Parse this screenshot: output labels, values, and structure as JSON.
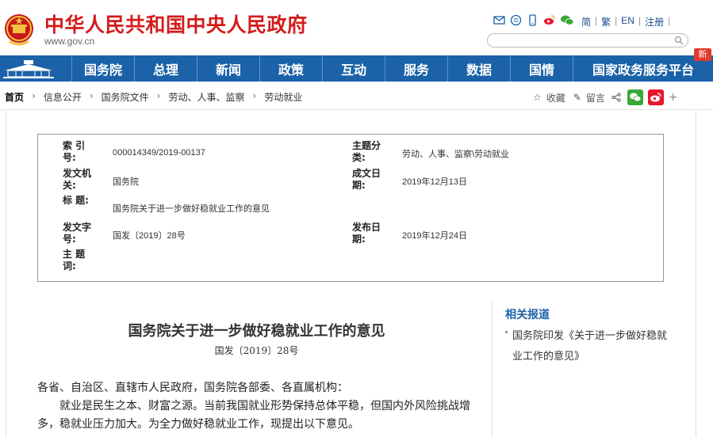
{
  "header": {
    "title": "中华人民共和国中央人民政府",
    "domain": "www.gov.cn",
    "lang_links": [
      "简",
      "繁",
      "EN",
      "注册"
    ],
    "search": {
      "placeholder": "",
      "value": ""
    }
  },
  "nav": {
    "items": [
      "国务院",
      "总理",
      "新闻",
      "政策",
      "互动",
      "服务",
      "数据",
      "国情",
      "国家政务服务平台"
    ],
    "badge": "新"
  },
  "breadcrumb": {
    "items": [
      "首页",
      "信息公开",
      "国务院文件",
      "劳动、人事、监察",
      "劳动就业"
    ]
  },
  "tools": {
    "favorite": "收藏",
    "comment": "留言",
    "more": "+"
  },
  "info": {
    "index_label": "索 引 号:",
    "index_value": "000014349/2019-00137",
    "category_label": "主题分类:",
    "category_value": "劳动、人事、监察\\劳动就业",
    "issuer_label": "发文机关:",
    "issuer_value": "国务院",
    "date_written_label": "成文日期:",
    "date_written_value": "2019年12月13日",
    "title_label": "标 题:",
    "title_value": "国务院关于进一步做好稳就业工作的意见",
    "doc_no_label": "发文字号:",
    "doc_no_value": "国发〔2019〕28号",
    "publish_label": "发布日期:",
    "publish_value": "2019年12月24日",
    "keywords_label": "主 题 词:",
    "keywords_value": ""
  },
  "article": {
    "title": "国务院关于进一步做好稳就业工作的意见",
    "doc_no": "国发〔2019〕28号",
    "salutation": "各省、自治区、直辖市人民政府，国务院各部委、各直属机构：",
    "para1_line1": "就业是民生之本、财富之源。当前我国就业形势保持总体平稳，但国内外风险挑战增",
    "para1_line2": "多，稳就业压力加大。为全力做好稳就业工作，现提出以下意见。"
  },
  "sidebar": {
    "heading": "相关报道",
    "links": [
      "国务院印发《关于进一步做好稳就业工作的意见》"
    ]
  },
  "colors": {
    "brand_red": "#d41c1c",
    "nav_blue": "#1b62a8"
  }
}
